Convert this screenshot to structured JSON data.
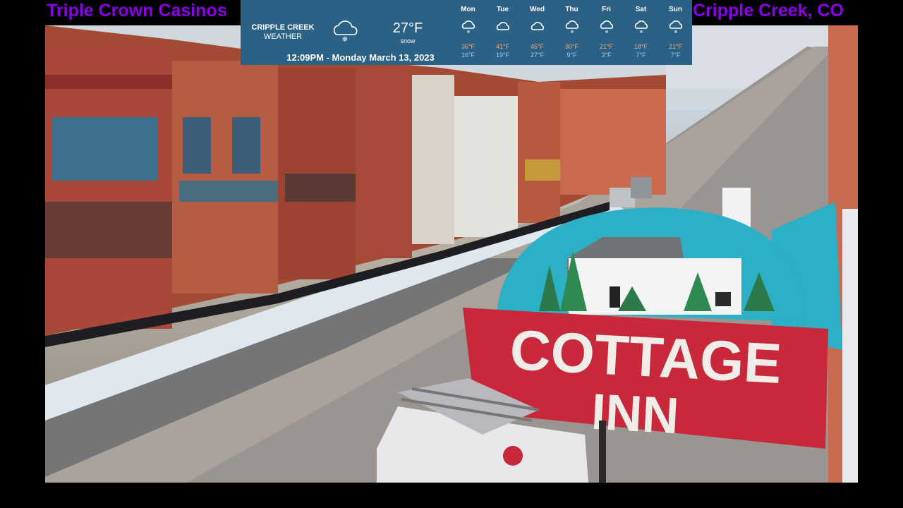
{
  "captions": {
    "left": "Triple Crown Casinos",
    "right": "Cripple Creek, CO",
    "color": "#8b00e8"
  },
  "weather": {
    "location_line1": "CRIPPLE CREEK",
    "location_line2": "WEATHER",
    "current_icon": "cloud-snow-icon",
    "temperature": "27°F",
    "condition": "snow",
    "datetime": "12:09PM - Monday March 13, 2023",
    "forecast": [
      {
        "day": "Mon",
        "icon": "cloud-snow-icon",
        "high": "36°F",
        "low": "16°F"
      },
      {
        "day": "Tue",
        "icon": "cloud-icon",
        "high": "41°F",
        "low": "19°F"
      },
      {
        "day": "Wed",
        "icon": "cloud-icon",
        "high": "45°F",
        "low": "27°F"
      },
      {
        "day": "Thu",
        "icon": "cloud-snow-icon",
        "high": "30°F",
        "low": "9°F"
      },
      {
        "day": "Fri",
        "icon": "cloud-snow-icon",
        "high": "21°F",
        "low": "3°F"
      },
      {
        "day": "Sat",
        "icon": "cloud-snow-icon",
        "high": "18°F",
        "low": "7°F"
      },
      {
        "day": "Sun",
        "icon": "cloud-snow-icon",
        "high": "21°F",
        "low": "7°F"
      }
    ]
  },
  "scene": {
    "sign_line1": "COTTAGE",
    "sign_line2": "INN",
    "sign_color": "#c8283a",
    "awning_color": "#2bb0c6"
  }
}
